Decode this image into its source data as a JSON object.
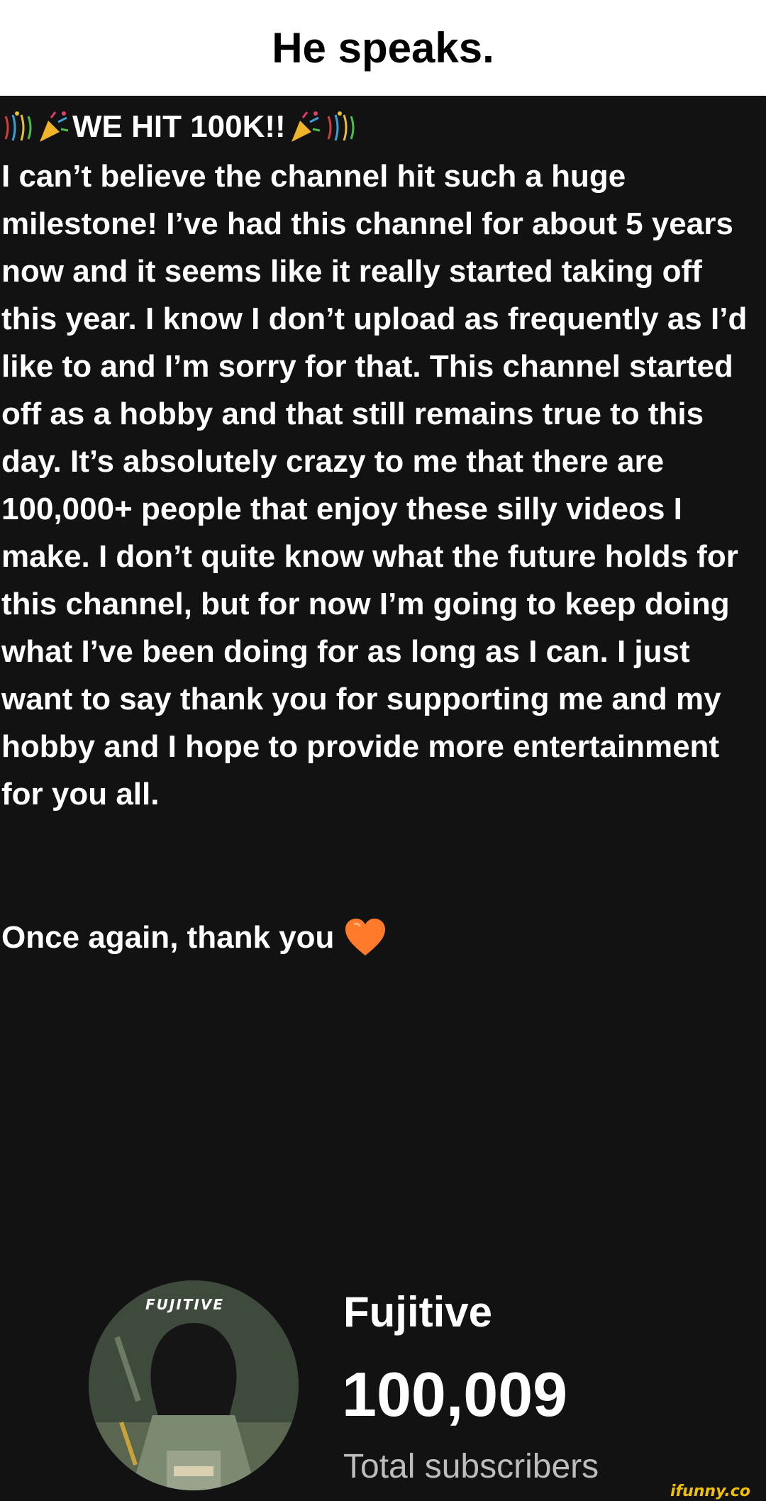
{
  "caption": "He speaks.",
  "post": {
    "headline": "WE HIT 100K!!",
    "headline_emojis": [
      "confetti-icon",
      "party-popper-icon",
      "party-popper-icon",
      "confetti-icon"
    ],
    "body": "I can’t believe the channel hit such a huge milestone! I’ve had this channel for about 5 years now and it seems like it really started taking off this year. I know I don’t upload as frequently as I’d like to and I’m sorry for that. This channel started off as a hobby and that still remains true to this day. It’s absolutely crazy to me that there are 100,000+ people that enjoy these silly videos I make. I don’t quite know what the future holds for this channel, but for now I’m going to keep doing what I’ve been doing for as long as I can. I just want to say thank you for supporting me and my hobby and I hope to provide more entertainment for you all.",
    "closing": "Once again, thank you",
    "closing_emoji": "orange-heart-icon"
  },
  "channel": {
    "avatar_logo": "FUJITIVE",
    "name": "Fujitive",
    "subscriber_count": "100,009",
    "subscriber_label": "Total subscribers"
  },
  "watermark": "ifunny.co",
  "colors": {
    "background": "#121212",
    "caption_bg": "#ffffff",
    "text": "#ffffff",
    "muted_text": "#bdbdbd",
    "heart": "#ff7a2a",
    "watermark": "#f2c200"
  }
}
